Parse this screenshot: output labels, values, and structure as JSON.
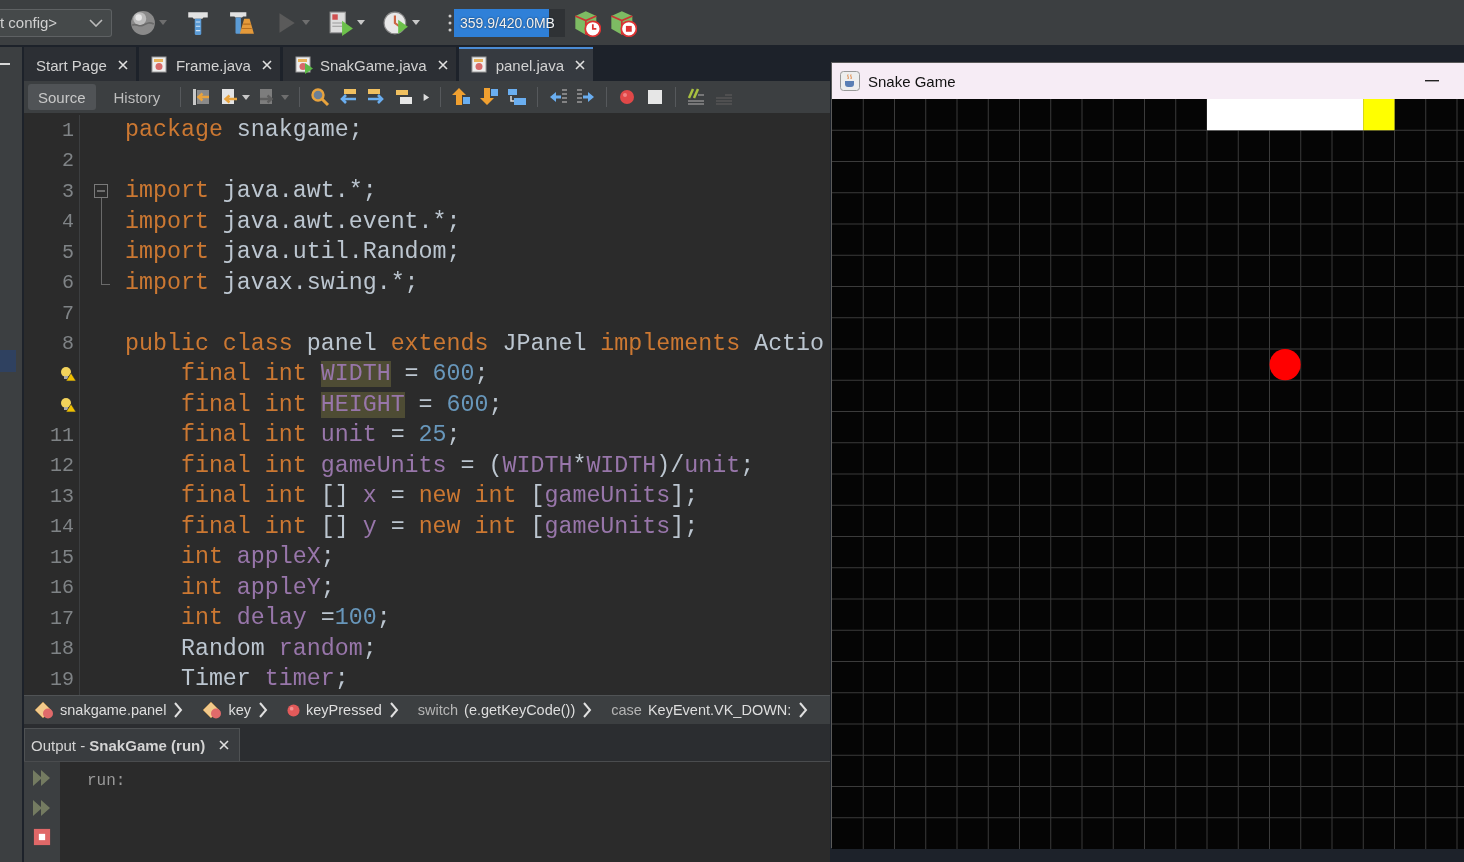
{
  "main_toolbar": {
    "configuration": "t config>",
    "buttons": [
      {
        "kind": "globe",
        "disabled": false
      },
      {
        "kind": "dropdown",
        "disabled": true
      },
      {
        "kind": "hammer",
        "disabled": false
      },
      {
        "kind": "hammer-broom",
        "disabled": false
      },
      {
        "kind": "run",
        "disabled": true
      },
      {
        "kind": "dropdown",
        "disabled": true
      },
      {
        "kind": "debug",
        "disabled": false
      },
      {
        "kind": "dropdown",
        "disabled": false
      },
      {
        "kind": "profile",
        "disabled": false
      },
      {
        "kind": "dropdown",
        "disabled": false
      }
    ],
    "memory": {
      "reading": "359.9/420.0MB",
      "level": 0.86
    },
    "trailing_buttons": [
      {
        "kind": "cube-clock",
        "disabled": false
      },
      {
        "kind": "cube-stop",
        "disabled": false
      }
    ]
  },
  "tabs": [
    {
      "label": "Start Page",
      "kind": "page",
      "selected": false
    },
    {
      "label": "Frame.java",
      "kind": "class",
      "selected": false
    },
    {
      "label": "SnakGame.java",
      "kind": "main-class",
      "selected": false
    },
    {
      "label": "panel.java",
      "kind": "class",
      "selected": true
    }
  ],
  "editor_toolbar": {
    "views": [
      {
        "label": "Source",
        "selected": true
      },
      {
        "label": "History",
        "selected": false
      }
    ],
    "groups": [
      [
        {
          "kind": "last-edit",
          "disabled": false
        },
        {
          "kind": "back",
          "disabled": false
        },
        {
          "kind": "dropdown",
          "disabled": false
        },
        {
          "kind": "forward",
          "disabled": true
        },
        {
          "kind": "dropdown",
          "disabled": true
        }
      ],
      [
        {
          "kind": "find",
          "disabled": false
        },
        {
          "kind": "previous-occurrence",
          "disabled": false
        },
        {
          "kind": "next-occurrence",
          "disabled": false
        },
        {
          "kind": "toggle-highlight",
          "disabled": false
        },
        {
          "kind": "more",
          "disabled": false
        }
      ],
      [
        {
          "kind": "shift-up",
          "disabled": false
        },
        {
          "kind": "shift-down",
          "disabled": false
        },
        {
          "kind": "arrange",
          "disabled": false
        }
      ],
      [
        {
          "kind": "shift-left",
          "disabled": false
        },
        {
          "kind": "shift-right",
          "disabled": false
        }
      ],
      [
        {
          "kind": "record",
          "disabled": false
        },
        {
          "kind": "stop",
          "disabled": false
        }
      ],
      [
        {
          "kind": "comment",
          "disabled": false
        },
        {
          "kind": "uncomment",
          "disabled": true
        }
      ]
    ]
  },
  "code": {
    "lines": [
      {
        "number": "1",
        "hint": false,
        "tokens": [
          {
            "text": "package",
            "kind": "keyword"
          },
          {
            "text": " snakgame;",
            "kind": "plain"
          }
        ]
      },
      {
        "number": "2",
        "hint": false
      },
      {
        "number": "3",
        "hint": false,
        "fold": {
          "kind": "start",
          "expanded": true
        },
        "tokens": [
          {
            "text": "import",
            "kind": "keyword"
          },
          {
            "text": " java.awt.*;",
            "kind": "plain"
          }
        ]
      },
      {
        "number": "4",
        "hint": false,
        "fold": {
          "kind": "inside"
        },
        "tokens": [
          {
            "text": "import",
            "kind": "keyword"
          },
          {
            "text": " java.awt.event.*;",
            "kind": "plain"
          }
        ]
      },
      {
        "number": "5",
        "hint": false,
        "fold": {
          "kind": "inside"
        },
        "tokens": [
          {
            "text": "import",
            "kind": "keyword"
          },
          {
            "text": " java.util.Random;",
            "kind": "plain"
          }
        ]
      },
      {
        "number": "6",
        "hint": false,
        "fold": {
          "kind": "end"
        },
        "tokens": [
          {
            "text": "import",
            "kind": "keyword"
          },
          {
            "text": " javax.swing.*;",
            "kind": "plain"
          }
        ]
      },
      {
        "number": "7",
        "hint": false
      },
      {
        "number": "8",
        "hint": false,
        "tokens": [
          {
            "text": "public class",
            "kind": "keyword"
          },
          {
            "text": " panel ",
            "kind": "plain"
          },
          {
            "text": "extends",
            "kind": "keyword"
          },
          {
            "text": " JPanel ",
            "kind": "plain"
          },
          {
            "text": "implements",
            "kind": "keyword"
          },
          {
            "text": " Actio",
            "kind": "plain"
          }
        ]
      },
      {
        "hint": true,
        "tokens": [
          {
            "text": "    final int ",
            "kind": "keyword"
          },
          {
            "text": "WIDTH",
            "kind": "occurrence"
          },
          {
            "text": " = ",
            "kind": "plain"
          },
          {
            "text": "600",
            "kind": "number"
          },
          {
            "text": ";",
            "kind": "plain"
          }
        ]
      },
      {
        "hint": true,
        "tokens": [
          {
            "text": "    final int ",
            "kind": "keyword"
          },
          {
            "text": "HEIGHT",
            "kind": "occurrence"
          },
          {
            "text": " = ",
            "kind": "plain"
          },
          {
            "text": "600",
            "kind": "number"
          },
          {
            "text": ";",
            "kind": "plain"
          }
        ]
      },
      {
        "number": "11",
        "hint": false,
        "tokens": [
          {
            "text": "    final int ",
            "kind": "keyword"
          },
          {
            "text": "unit",
            "kind": "field"
          },
          {
            "text": " = ",
            "kind": "plain"
          },
          {
            "text": "25",
            "kind": "number"
          },
          {
            "text": ";",
            "kind": "plain"
          }
        ]
      },
      {
        "number": "12",
        "hint": false,
        "tokens": [
          {
            "text": "    final int ",
            "kind": "keyword"
          },
          {
            "text": "gameUnits",
            "kind": "field"
          },
          {
            "text": " = (",
            "kind": "plain"
          },
          {
            "text": "WIDTH",
            "kind": "field"
          },
          {
            "text": "*",
            "kind": "plain"
          },
          {
            "text": "WIDTH",
            "kind": "field"
          },
          {
            "text": ")/",
            "kind": "plain"
          },
          {
            "text": "unit",
            "kind": "field"
          },
          {
            "text": ";",
            "kind": "plain"
          }
        ]
      },
      {
        "number": "13",
        "hint": false,
        "tokens": [
          {
            "text": "    final int ",
            "kind": "keyword"
          },
          {
            "text": "[] ",
            "kind": "plain"
          },
          {
            "text": "x",
            "kind": "field"
          },
          {
            "text": " = ",
            "kind": "plain"
          },
          {
            "text": "new int ",
            "kind": "keyword"
          },
          {
            "text": "[",
            "kind": "plain"
          },
          {
            "text": "gameUnits",
            "kind": "field"
          },
          {
            "text": "];",
            "kind": "plain"
          }
        ]
      },
      {
        "number": "14",
        "hint": false,
        "tokens": [
          {
            "text": "    final int ",
            "kind": "keyword"
          },
          {
            "text": "[] ",
            "kind": "plain"
          },
          {
            "text": "y",
            "kind": "field"
          },
          {
            "text": " = ",
            "kind": "plain"
          },
          {
            "text": "new int ",
            "kind": "keyword"
          },
          {
            "text": "[",
            "kind": "plain"
          },
          {
            "text": "gameUnits",
            "kind": "field"
          },
          {
            "text": "];",
            "kind": "plain"
          }
        ]
      },
      {
        "number": "15",
        "hint": false,
        "tokens": [
          {
            "text": "    int ",
            "kind": "keyword"
          },
          {
            "text": "appleX",
            "kind": "field"
          },
          {
            "text": ";",
            "kind": "plain"
          }
        ]
      },
      {
        "number": "16",
        "hint": false,
        "tokens": [
          {
            "text": "    int ",
            "kind": "keyword"
          },
          {
            "text": "appleY",
            "kind": "field"
          },
          {
            "text": ";",
            "kind": "plain"
          }
        ]
      },
      {
        "number": "17",
        "hint": false,
        "tokens": [
          {
            "text": "    int ",
            "kind": "keyword"
          },
          {
            "text": "delay",
            "kind": "field"
          },
          {
            "text": " =",
            "kind": "plain"
          },
          {
            "text": "100",
            "kind": "number"
          },
          {
            "text": ";",
            "kind": "plain"
          }
        ]
      },
      {
        "number": "18",
        "hint": false,
        "tokens": [
          {
            "text": "    Random ",
            "kind": "plain"
          },
          {
            "text": "random",
            "kind": "field"
          },
          {
            "text": ";",
            "kind": "plain"
          }
        ]
      },
      {
        "number": "19",
        "hint": false,
        "tokens": [
          {
            "text": "    Timer ",
            "kind": "plain"
          },
          {
            "text": "timer",
            "kind": "field"
          },
          {
            "text": ";",
            "kind": "plain"
          }
        ]
      }
    ]
  },
  "breadcrumbs": [
    {
      "kind": "class",
      "text": "snakgame.panel"
    },
    {
      "kind": "class",
      "text": "key"
    },
    {
      "kind": "method",
      "text": "keyPressed"
    },
    {
      "kind": "statement",
      "keyword": "switch",
      "text": "(e.getKeyCode())"
    },
    {
      "kind": "statement",
      "keyword": "case",
      "text": "KeyEvent.VK_DOWN:"
    }
  ],
  "output": {
    "tab": {
      "label": "Output - **SnakGame (run)**",
      "selected": true
    },
    "actions": [
      {
        "kind": "rerun",
        "disabled": true
      },
      {
        "kind": "rerun-options",
        "disabled": true
      },
      {
        "kind": "stop",
        "disabled": false
      }
    ],
    "text": "run:"
  },
  "game_window": {
    "title": "Snake Game"
  }
}
